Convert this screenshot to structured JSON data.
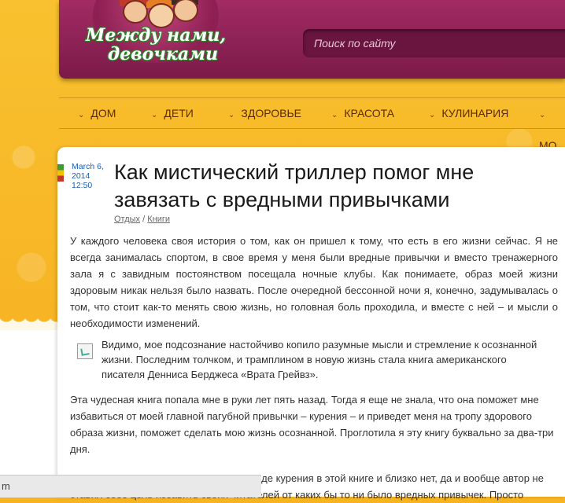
{
  "site": {
    "logo_line1": "Между нами,",
    "logo_line2": "девочками",
    "search_placeholder": "Поиск по сайту"
  },
  "nav": {
    "items": [
      {
        "label": "ДОМ"
      },
      {
        "label": "ДЕТИ"
      },
      {
        "label": "ЗДОРОВЬЕ"
      },
      {
        "label": "КРАСОТА"
      },
      {
        "label": "КУЛИНАРИЯ"
      },
      {
        "label": "МО"
      }
    ]
  },
  "article": {
    "date_line1": "March 6,",
    "date_line2": "2014",
    "date_line3": "12:50",
    "title": "Как мистический триллер помог мне завязать с вредными привычками",
    "category1": "Отдых",
    "separator": "/",
    "category2": "Книги",
    "p1": "У каждого человека своя история о том, как он пришел к тому, что есть в его жизни сейчас. Я не всегда занималась спортом, в свое время у меня были вредные привычки и вместо тренажерного зала я с завидным постоянством посещала ночные клубы. Как понимаете, образ моей жизни здоровым никак нельзя было назвать. После очередной бессонной ночи я, конечно, задумывалась о том, что стоит как-то менять свою жизнь, но головная боль проходила, и вместе с ней – и мысли о необходимости изменений.",
    "quote": "Видимо, мое подсознание настойчиво копило разумные мысли и стремление к осознанной жизни. Последним толчком, и трамплином в новую жизнь стала книга американского писателя Денниса Берджеса «Врата Грейвз».",
    "p2": "Эта чудесная книга попала мне в руки лет пять назад. Тогда я еще не знала, что она поможет мне избавиться от моей главной пагубной привычки – курения – и приведет меня на тропу здорового образа жизни, поможет сделать мою жизнь осознанной. Проглотила я эту книгу буквально за два-три дня.",
    "p3": "Сразу скажу, что никаких лозунгов о вреде курения в этой книге и близко нет, да и вообще автор не ставил себе цель избавить своих читателей от каких бы то ни было вредных привычек. Просто"
  },
  "statusbar": {
    "text": "m"
  }
}
